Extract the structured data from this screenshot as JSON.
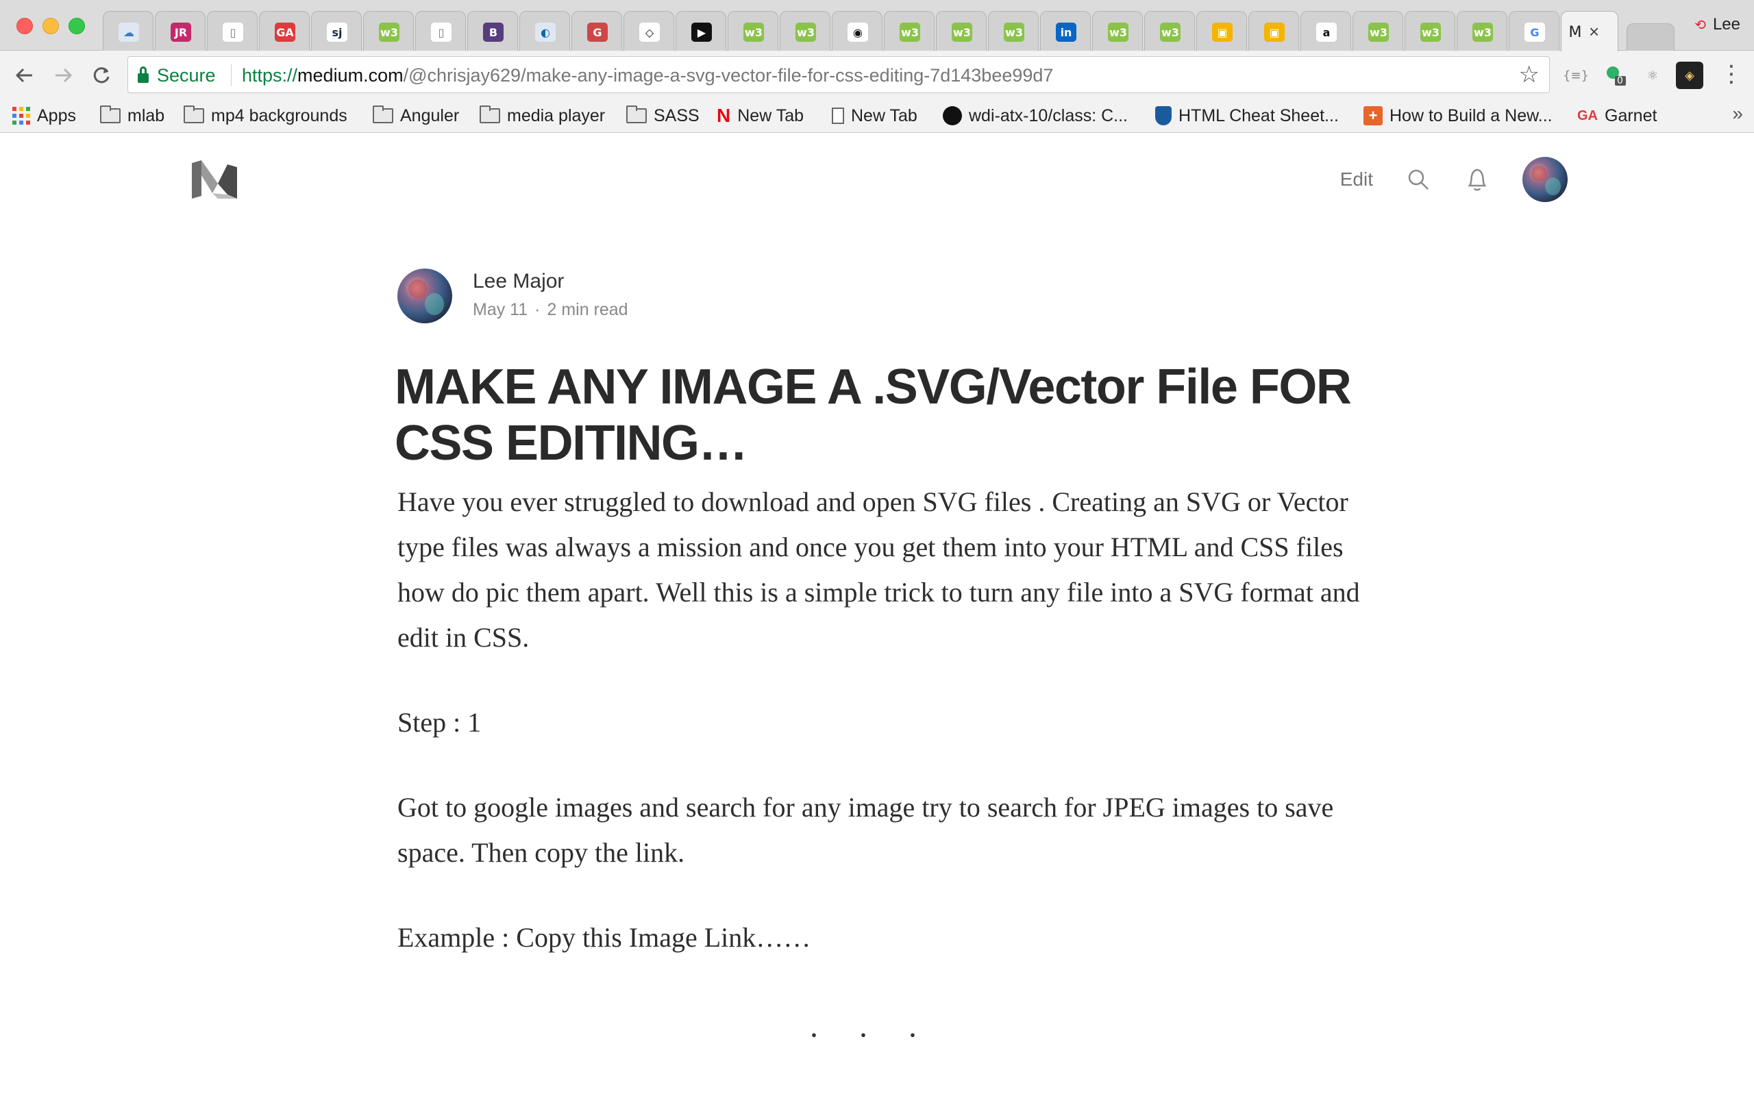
{
  "browser": {
    "tabs": [
      {
        "icon": "cloud-icon",
        "label": "",
        "color": "#dfe8f2",
        "fg": "#3b7bbf",
        "glyph": "☁"
      },
      {
        "icon": "jr-icon",
        "label": "",
        "color": "#c6286c",
        "fg": "#ffffff",
        "glyph": "JR"
      },
      {
        "icon": "document-icon",
        "label": "",
        "color": "#ffffff",
        "fg": "#777777",
        "glyph": "▯"
      },
      {
        "icon": "ga-icon",
        "label": "",
        "color": "#e03a3e",
        "fg": "#ffffff",
        "glyph": "GA"
      },
      {
        "icon": "sj-icon",
        "label": "",
        "color": "#ffffff",
        "fg": "#1a2b4a",
        "glyph": "sj"
      },
      {
        "icon": "w3schools-icon",
        "label": "",
        "color": "#8bc34a",
        "fg": "#ffffff",
        "glyph": "w3"
      },
      {
        "icon": "document-icon",
        "label": "",
        "color": "#ffffff",
        "fg": "#777777",
        "glyph": "▯"
      },
      {
        "icon": "bootstrap-icon",
        "label": "",
        "color": "#563d7c",
        "fg": "#ffffff",
        "glyph": "B"
      },
      {
        "icon": "jquery-icon",
        "label": "",
        "color": "#dfe8f2",
        "fg": "#0769ad",
        "glyph": "◐"
      },
      {
        "icon": "gulp-icon",
        "label": "",
        "color": "#cf4647",
        "fg": "#ffffff",
        "glyph": "G"
      },
      {
        "icon": "codepen-icon",
        "label": "",
        "color": "#ffffff",
        "fg": "#111111",
        "glyph": "◇"
      },
      {
        "icon": "youtube-icon",
        "label": "",
        "color": "#111111",
        "fg": "#ffffff",
        "glyph": "▶"
      },
      {
        "icon": "w3schools-icon",
        "label": "",
        "color": "#8bc34a",
        "fg": "#ffffff",
        "glyph": "w3"
      },
      {
        "icon": "w3schools-icon",
        "label": "",
        "color": "#8bc34a",
        "fg": "#ffffff",
        "glyph": "w3"
      },
      {
        "icon": "play-circle-icon",
        "label": "",
        "color": "#ffffff",
        "fg": "#111111",
        "glyph": "◉"
      },
      {
        "icon": "w3schools-icon",
        "label": "",
        "color": "#8bc34a",
        "fg": "#ffffff",
        "glyph": "w3"
      },
      {
        "icon": "w3schools-icon",
        "label": "",
        "color": "#8bc34a",
        "fg": "#ffffff",
        "glyph": "w3"
      },
      {
        "icon": "w3schools-icon",
        "label": "",
        "color": "#8bc34a",
        "fg": "#ffffff",
        "glyph": "w3"
      },
      {
        "icon": "linkedin-icon",
        "label": "",
        "color": "#0a66c2",
        "fg": "#ffffff",
        "glyph": "in"
      },
      {
        "icon": "w3schools-icon",
        "label": "",
        "color": "#8bc34a",
        "fg": "#ffffff",
        "glyph": "w3"
      },
      {
        "icon": "w3schools-icon",
        "label": "",
        "color": "#8bc34a",
        "fg": "#ffffff",
        "glyph": "w3"
      },
      {
        "icon": "package-icon",
        "label": "",
        "color": "#f4b400",
        "fg": "#ffffff",
        "glyph": "▣"
      },
      {
        "icon": "package-icon",
        "label": "",
        "color": "#f4b400",
        "fg": "#ffffff",
        "glyph": "▣"
      },
      {
        "icon": "amazon-icon",
        "label": "",
        "color": "#ffffff",
        "fg": "#111111",
        "glyph": "a"
      },
      {
        "icon": "w3schools-icon",
        "label": "",
        "color": "#8bc34a",
        "fg": "#ffffff",
        "glyph": "w3"
      },
      {
        "icon": "w3schools-icon",
        "label": "",
        "color": "#8bc34a",
        "fg": "#ffffff",
        "glyph": "w3"
      },
      {
        "icon": "w3schools-icon",
        "label": "",
        "color": "#8bc34a",
        "fg": "#ffffff",
        "glyph": "w3"
      },
      {
        "icon": "google-icon",
        "label": "",
        "color": "#ffffff",
        "fg": "#4285f4",
        "glyph": "G"
      }
    ],
    "active_tab": {
      "label": "M",
      "close": "×"
    },
    "profile_name": "Lee",
    "address": {
      "secure_label": "Secure",
      "scheme": "https://",
      "host": "medium.com",
      "path": "/@chrisjay629/make-any-image-a-svg-vector-file-for-css-editing-7d143bee99d7"
    },
    "extensions": [
      "json-viewer-icon",
      "extension-badge-icon",
      "react-devtools-icon",
      "dark-extension-icon"
    ],
    "extension_badge": "0",
    "bookmarks": [
      {
        "type": "apps",
        "label": "Apps"
      },
      {
        "type": "folder",
        "label": "mlab"
      },
      {
        "type": "folder",
        "label": "mp4 backgrounds"
      },
      {
        "type": "folder",
        "label": "Anguler"
      },
      {
        "type": "folder",
        "label": "media player"
      },
      {
        "type": "folder",
        "label": "SASS"
      },
      {
        "type": "netflix",
        "label": "New Tab"
      },
      {
        "type": "page",
        "label": "New Tab"
      },
      {
        "type": "github",
        "label": "wdi-atx-10/class: C..."
      },
      {
        "type": "shield",
        "label": "HTML Cheat Sheet..."
      },
      {
        "type": "plus",
        "label": "How to Build a New..."
      },
      {
        "type": "ga",
        "label": "Garnet"
      }
    ],
    "bookmarks_more": "»"
  },
  "medium": {
    "edit_label": "Edit",
    "author": {
      "name": "Lee Major",
      "date": "May 11",
      "read_time": "2 min read",
      "sep": "·"
    },
    "title": "MAKE ANY IMAGE A .SVG/Vector File FOR CSS EDITING…",
    "paragraphs": [
      "Have you ever struggled to download and open SVG files . Creating an SVG or Vector type files was always a mission and once you get them into your HTML and CSS files how do pic them apart. Well this is a simple trick to turn any file into a SVG format and edit in CSS.",
      "Step : 1",
      "Got to google images and search for any image try to search for JPEG images to save space. Then copy the link.",
      "Example : Copy this Image Link……"
    ],
    "separator": "· · ·"
  },
  "colors": {
    "secure_green": "#0b8043",
    "text_dark": "#2e2e2e",
    "meta_gray": "#888888"
  }
}
